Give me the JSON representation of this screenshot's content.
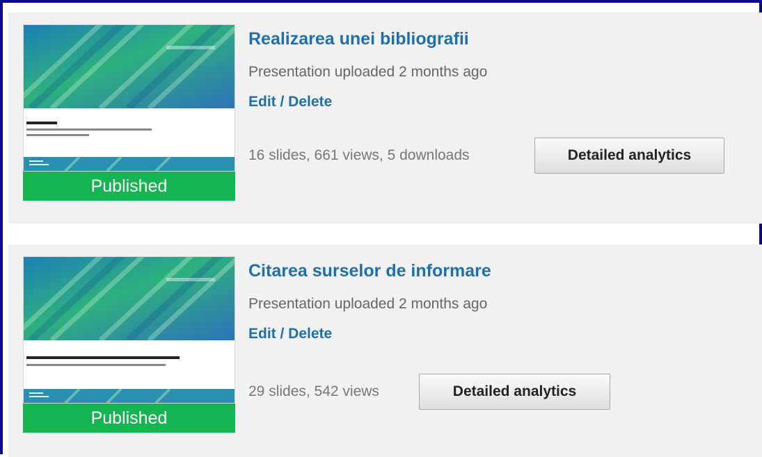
{
  "presentations": [
    {
      "title": "Realizarea unei bibliografii",
      "uploaded": "Presentation uploaded 2 months ago",
      "edit_label": "Edit / Delete",
      "stats": "16 slides, 661 views, 5 downloads",
      "analytics_label": "Detailed analytics",
      "status": "Published"
    },
    {
      "title": "Citarea surselor de informare",
      "uploaded": "Presentation uploaded 2 months ago",
      "edit_label": "Edit / Delete",
      "stats": "29 slides, 542 views",
      "analytics_label": "Detailed analytics",
      "status": "Published"
    }
  ],
  "colors": {
    "frame_border": "#0a0a8c",
    "card_background": "#f1f1f1",
    "link": "#1f6fad",
    "published_badge": "#16b552"
  }
}
